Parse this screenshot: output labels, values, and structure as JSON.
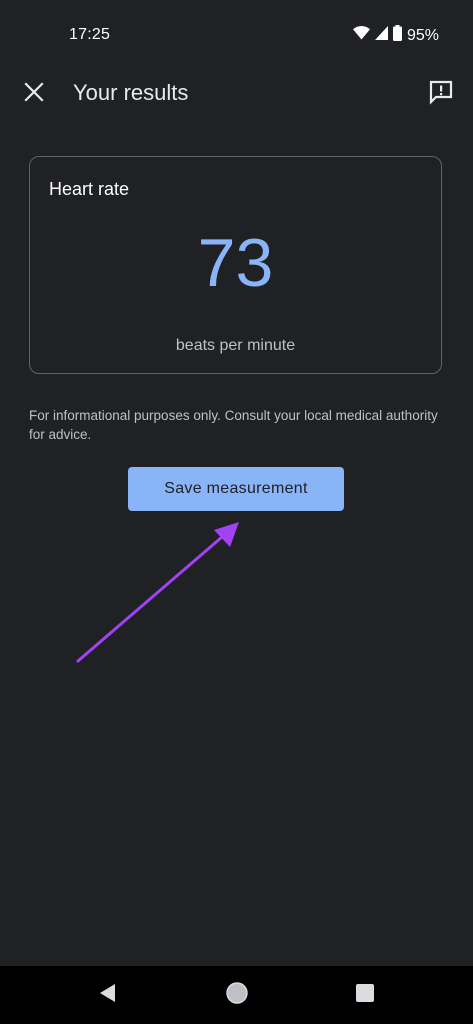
{
  "status_bar": {
    "time": "17:25",
    "battery_percent": "95%",
    "icons": [
      "wifi-icon",
      "cell-signal-icon",
      "battery-icon"
    ]
  },
  "app_bar": {
    "title": "Your results",
    "close_icon": "close-icon",
    "feedback_icon": "feedback-icon"
  },
  "result_card": {
    "label": "Heart rate",
    "value": "73",
    "unit": "beats per minute"
  },
  "disclaimer": "For informational purposes only. Consult your local medical authority for advice.",
  "save_button_label": "Save measurement",
  "colors": {
    "background": "#202124",
    "accent": "#8ab4f8",
    "annotation_arrow": "#a142f4"
  },
  "navigation": {
    "icons": [
      "back-icon",
      "home-icon",
      "recents-icon"
    ]
  }
}
